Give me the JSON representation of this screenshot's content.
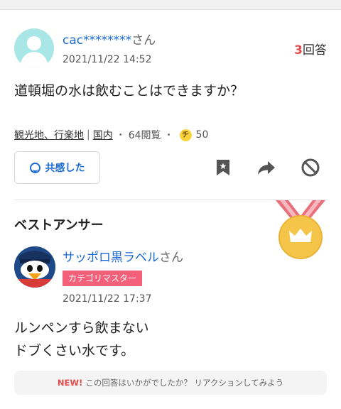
{
  "question": {
    "user_name": "cac********",
    "user_suffix": "さん",
    "date": "2021/11/22 14:52",
    "answer_count": "3",
    "answer_label": "回答",
    "text": "道頓堀の水は飲むことはできますか？",
    "categories": [
      "観光地、行楽地",
      "国内"
    ],
    "category_separator": "|",
    "views": "64閲覧",
    "coin_symbol": "チ",
    "coins": "50",
    "empathy_label": "共感した"
  },
  "best_answer": {
    "heading": "ベストアンサー",
    "user_name": "サッポロ黒ラベル",
    "user_suffix": "さん",
    "badge": "カテゴリマスター",
    "date": "2021/11/22 17:37",
    "text_lines": [
      "ルンペンすら飲まない",
      "ドブくさい水です。"
    ]
  },
  "reaction_prompt": {
    "new_label": "NEW!",
    "text": "この回答はいかがでしたか？ リアクションしてみよう"
  },
  "icons": [
    "user-silhouette-icon",
    "smile-icon",
    "bookmark-icon",
    "share-icon",
    "block-icon",
    "crown-medal-icon",
    "mascot-avatar"
  ],
  "colors": {
    "link_blue": "#1a6ad3",
    "answer_red": "#e54d4d",
    "badge_pink": "#f2607a",
    "coin_yellow": "#f9d53b",
    "medal_gold": "#f5c54a"
  }
}
